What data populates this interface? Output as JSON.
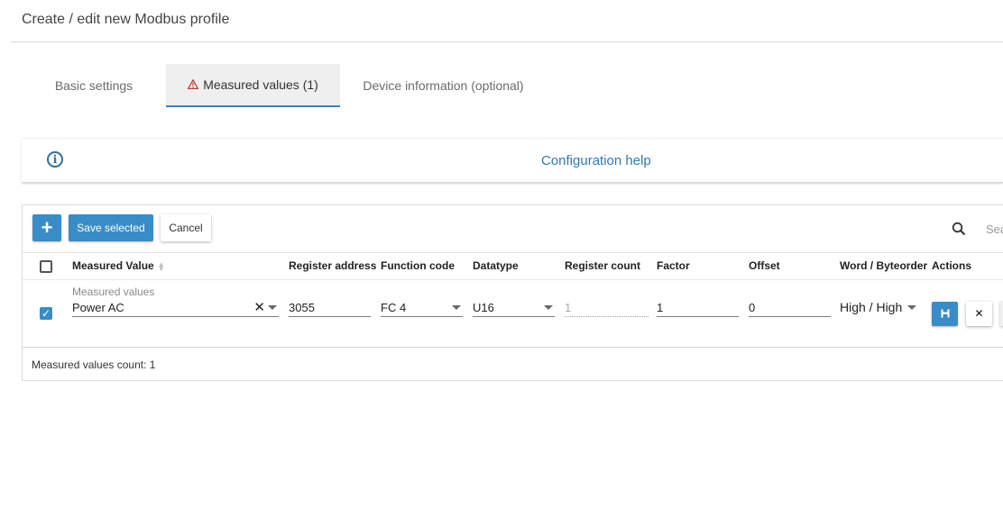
{
  "page": {
    "title": "Create / edit new Modbus profile"
  },
  "tabs": [
    {
      "label": "Basic settings"
    },
    {
      "label": "Measured values (1)",
      "active": true,
      "icon": "warning-icon"
    },
    {
      "label": "Device information (optional)"
    }
  ],
  "help": {
    "label": "Configuration help",
    "icon": "info-icon"
  },
  "toolbar": {
    "add_icon": "plus-icon",
    "save_label": "Save selected",
    "cancel_label": "Cancel",
    "search_placeholder": "Search"
  },
  "table": {
    "columns": [
      "Measured Value",
      "Register address",
      "Function code",
      "Datatype",
      "Register count",
      "Factor",
      "Offset",
      "Word / Byteorder",
      "Actions"
    ],
    "rows": [
      {
        "selected": true,
        "measured_value_label": "Measured values",
        "measured_value": "Power AC",
        "register_address": "3055",
        "function_code": "FC 4",
        "datatype": "U16",
        "register_count": "1",
        "factor": "1",
        "offset": "0",
        "byteorder": "High / High"
      }
    ]
  },
  "footer": {
    "count_text": "Measured values count: 1"
  },
  "colors": {
    "accent": "#3a8cc7",
    "link": "#2f78b4",
    "warning": "#c0392b"
  }
}
